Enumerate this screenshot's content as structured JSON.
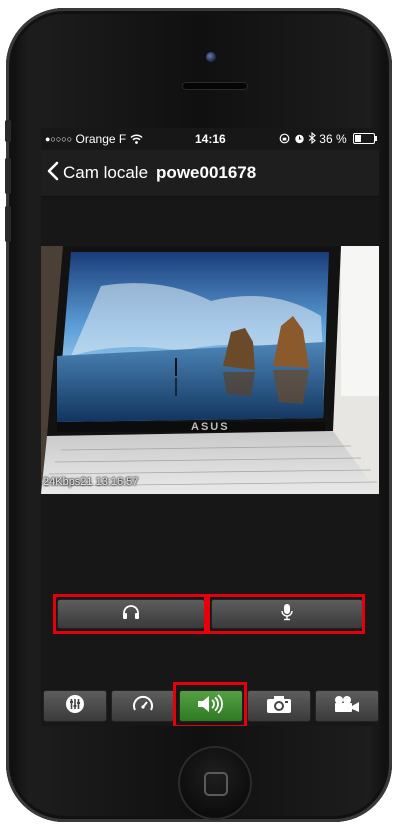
{
  "status_bar": {
    "signal": "●○○○○",
    "carrier": "Orange F",
    "wifi_icon": "wifi-icon",
    "time": "14:16",
    "battery_percent": "36 %",
    "battery_level": 0.36
  },
  "nav": {
    "back_label": "Cam locale",
    "title": "powe001678"
  },
  "video": {
    "overlay_text": "24Kbps21 13:16:57",
    "brand": "ASUS"
  },
  "controls": {
    "listen_icon": "headphones-icon",
    "talk_icon": "microphone-icon"
  },
  "toolbar": {
    "items": [
      {
        "icon": "equalizer-icon",
        "active": false
      },
      {
        "icon": "speedometer-icon",
        "active": false
      },
      {
        "icon": "speaker-icon",
        "active": true
      },
      {
        "icon": "camera-icon",
        "active": false
      },
      {
        "icon": "video-camera-icon",
        "active": false
      }
    ]
  },
  "colors": {
    "highlight": "#e6000b",
    "active_button": "#3f8f2f",
    "screen_bg": "#171717"
  }
}
